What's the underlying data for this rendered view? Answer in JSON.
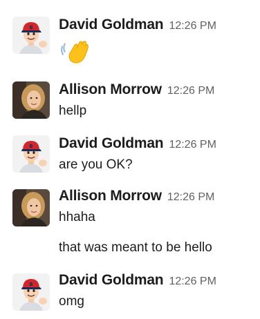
{
  "messages": [
    {
      "author": "David Goldman",
      "time": "12:26 PM",
      "avatar_icon": "cartoon-boy-red-cap",
      "content_emoji": "waving-hand-emoji"
    },
    {
      "author": "Allison Morrow",
      "time": "12:26 PM",
      "avatar_icon": "photo-woman-blonde",
      "lines": [
        "hellp"
      ]
    },
    {
      "author": "David Goldman",
      "time": "12:26 PM",
      "avatar_icon": "cartoon-boy-red-cap",
      "lines": [
        "are you OK?"
      ]
    },
    {
      "author": "Allison Morrow",
      "time": "12:26 PM",
      "avatar_icon": "photo-woman-blonde",
      "lines": [
        "hhaha",
        "that was meant to be hello"
      ]
    },
    {
      "author": "David Goldman",
      "time": "12:26 PM",
      "avatar_icon": "cartoon-boy-red-cap",
      "lines": [
        "omg"
      ]
    }
  ],
  "colors": {
    "author_text": "#1d1c1d",
    "timestamp_text": "#616061",
    "cap_red": "#d0272d",
    "cap_navy": "#1c2b57"
  }
}
